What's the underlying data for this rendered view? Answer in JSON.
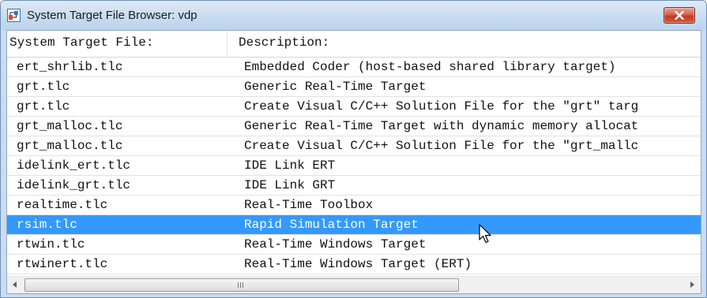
{
  "window": {
    "title": "System Target File Browser: vdp",
    "icon": "simulink-icon",
    "close_icon": "close-icon"
  },
  "table": {
    "columns": [
      "System Target File:",
      "Description:"
    ],
    "rows": [
      {
        "file": "ert_shrlib.tlc",
        "description": "Embedded Coder (host-based shared library target)"
      },
      {
        "file": "grt.tlc",
        "description": "Generic Real-Time Target"
      },
      {
        "file": "grt.tlc",
        "description": "Create Visual C/C++ Solution File for the \"grt\" targ"
      },
      {
        "file": "grt_malloc.tlc",
        "description": "Generic Real-Time Target with dynamic memory allocat"
      },
      {
        "file": "grt_malloc.tlc",
        "description": "Create Visual C/C++ Solution File for the \"grt_mallc"
      },
      {
        "file": "idelink_ert.tlc",
        "description": "IDE Link ERT"
      },
      {
        "file": "idelink_grt.tlc",
        "description": "IDE Link GRT"
      },
      {
        "file": "realtime.tlc",
        "description": "Real-Time Toolbox"
      },
      {
        "file": "rsim.tlc",
        "description": "Rapid Simulation Target",
        "selected": true
      },
      {
        "file": "rtwin.tlc",
        "description": "Real-Time Windows Target"
      },
      {
        "file": "rtwinert.tlc",
        "description": "Real-Time Windows Target (ERT)"
      }
    ],
    "selection_color": "#3399ff"
  },
  "scrollbar": {
    "left_icon": "arrow-left-icon",
    "right_icon": "arrow-right-icon"
  }
}
